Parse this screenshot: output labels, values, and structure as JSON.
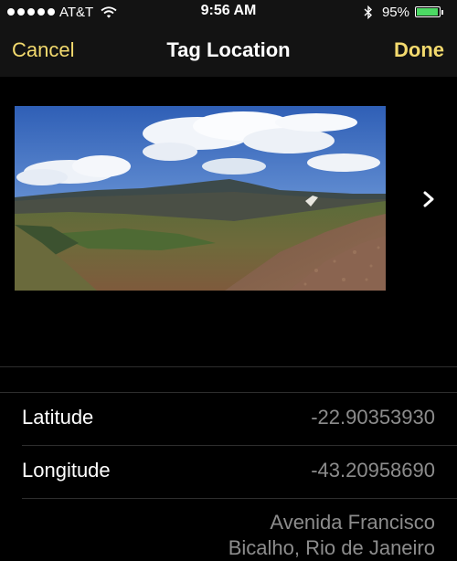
{
  "status_bar": {
    "carrier": "AT&T",
    "time": "9:56 AM",
    "battery_percent": "95%",
    "battery_level": 0.95,
    "battery_color": "#4cd964",
    "signal_bars": 5,
    "icons": [
      "wifi-icon",
      "bluetooth-icon",
      "battery-icon"
    ]
  },
  "nav": {
    "cancel_label": "Cancel",
    "title": "Tag Location",
    "done_label": "Done",
    "accent_color": "#f3da6e"
  },
  "photo": {
    "icon": "chevron-right-icon"
  },
  "location": {
    "latitude_label": "Latitude",
    "latitude_value": "-22.90353930",
    "longitude_label": "Longitude",
    "longitude_value": "-43.20958690",
    "address_line1": "Avenida Francisco",
    "address_line2": "Bicalho, Rio de Janeiro"
  }
}
